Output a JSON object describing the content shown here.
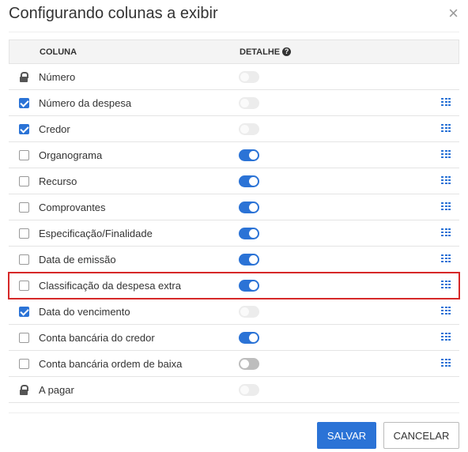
{
  "dialog": {
    "title": "Configurando colunas a exibir",
    "close_glyph": "×"
  },
  "table": {
    "headers": {
      "column": "COLUNA",
      "detail": "DETALHE",
      "help_glyph": "?"
    },
    "rows": [
      {
        "label": "Número",
        "indicator": "lock",
        "checked": false,
        "detail": "off",
        "reorder": false
      },
      {
        "label": "Número da despesa",
        "indicator": "checkbox",
        "checked": true,
        "detail": "off",
        "reorder": true
      },
      {
        "label": "Credor",
        "indicator": "checkbox",
        "checked": true,
        "detail": "off",
        "reorder": true
      },
      {
        "label": "Organograma",
        "indicator": "checkbox",
        "checked": false,
        "detail": "on",
        "reorder": true
      },
      {
        "label": "Recurso",
        "indicator": "checkbox",
        "checked": false,
        "detail": "on",
        "reorder": true
      },
      {
        "label": "Comprovantes",
        "indicator": "checkbox",
        "checked": false,
        "detail": "on",
        "reorder": true
      },
      {
        "label": "Especificação/Finalidade",
        "indicator": "checkbox",
        "checked": false,
        "detail": "on",
        "reorder": true
      },
      {
        "label": "Data de emissão",
        "indicator": "checkbox",
        "checked": false,
        "detail": "on",
        "reorder": true
      },
      {
        "label": "Classificação da despesa extra",
        "indicator": "checkbox",
        "checked": false,
        "detail": "on",
        "reorder": true,
        "highlighted": true
      },
      {
        "label": "Data do vencimento",
        "indicator": "checkbox",
        "checked": true,
        "detail": "off",
        "reorder": true
      },
      {
        "label": "Conta bancária do credor",
        "indicator": "checkbox",
        "checked": false,
        "detail": "on",
        "reorder": true
      },
      {
        "label": "Conta bancária ordem de baixa",
        "indicator": "checkbox",
        "checked": false,
        "detail": "offdark",
        "reorder": true
      },
      {
        "label": "A pagar",
        "indicator": "lock",
        "checked": false,
        "detail": "off",
        "reorder": false
      }
    ]
  },
  "footer": {
    "save_label": "SALVAR",
    "cancel_label": "CANCELAR"
  },
  "colors": {
    "accent": "#2b73d6",
    "highlight_border": "#d62828"
  },
  "icons": {
    "close": "close-icon",
    "help": "help-icon",
    "lock": "lock-icon",
    "reorder": "grid-icon"
  }
}
